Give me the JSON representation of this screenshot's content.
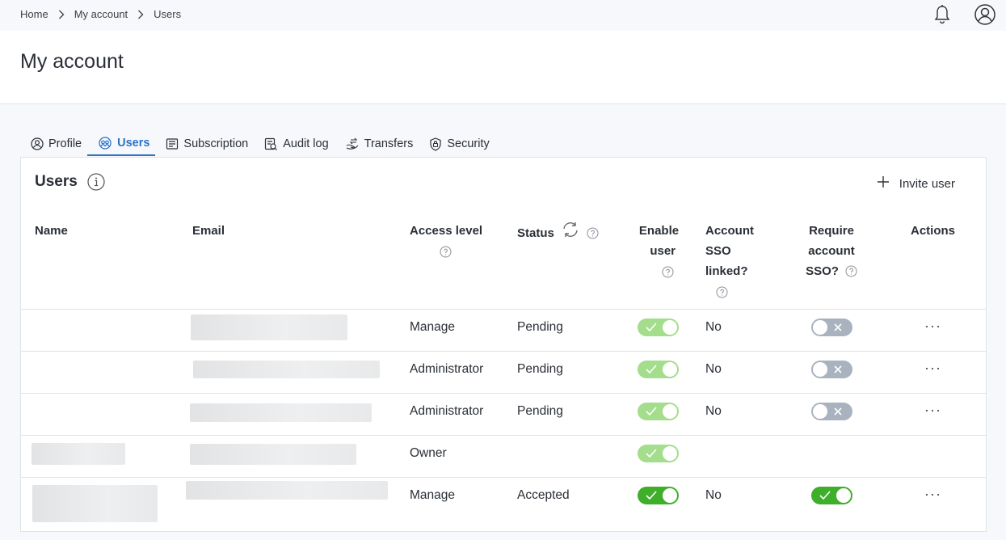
{
  "breadcrumb": {
    "home": "Home",
    "account": "My account",
    "current": "Users"
  },
  "header": {
    "title": "My account"
  },
  "tabs": [
    {
      "label": "Profile",
      "icon": "profile-icon"
    },
    {
      "label": "Users",
      "icon": "users-icon",
      "active": true
    },
    {
      "label": "Subscription",
      "icon": "subscription-icon"
    },
    {
      "label": "Audit log",
      "icon": "audit-log-icon"
    },
    {
      "label": "Transfers",
      "icon": "transfers-icon"
    },
    {
      "label": "Security",
      "icon": "shield-icon"
    }
  ],
  "panel": {
    "title": "Users",
    "invite_label": "Invite user"
  },
  "columns": {
    "name": "Name",
    "email": "Email",
    "access": "Access level",
    "status": "Status",
    "enable_1": "Enable",
    "enable_2": "user",
    "sso_1": "Account",
    "sso_2": "SSO",
    "sso_3": "linked?",
    "req_1": "Require",
    "req_2": "account",
    "req_3": "SSO?",
    "actions": "Actions"
  },
  "rows": [
    {
      "access": "Manage",
      "status": "Pending",
      "enable_user": true,
      "enable_state": "light",
      "sso_linked": "No",
      "require_sso": false,
      "actions": "···"
    },
    {
      "access": "Administrator",
      "status": "Pending",
      "enable_user": true,
      "enable_state": "light",
      "sso_linked": "No",
      "require_sso": false,
      "actions": "···"
    },
    {
      "access": "Administrator",
      "status": "Pending",
      "enable_user": true,
      "enable_state": "light",
      "sso_linked": "No",
      "require_sso": false,
      "actions": "···"
    },
    {
      "access": "Owner",
      "status": "",
      "enable_user": true,
      "enable_state": "light",
      "sso_linked": "",
      "require_sso": null,
      "actions": ""
    },
    {
      "access": "Manage",
      "status": "Accepted",
      "enable_user": true,
      "enable_state": "dark",
      "sso_linked": "No",
      "require_sso": true,
      "actions": "···"
    }
  ],
  "colors": {
    "accent": "#2d73c8",
    "toggle_on_light": "#a4dd8c",
    "toggle_on_dark": "#3fae2a",
    "toggle_off": "#a9b3bf"
  }
}
